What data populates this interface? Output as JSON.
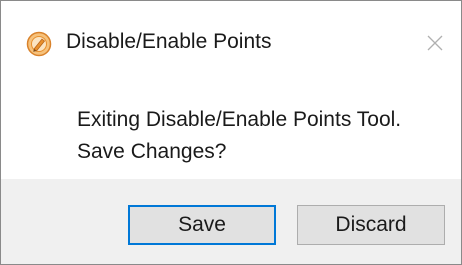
{
  "dialog": {
    "title": "Disable/Enable Points",
    "app_icon": "pen-circle-icon",
    "close_icon": "close-icon",
    "message_line1": "Exiting Disable/Enable Points Tool.",
    "message_line2": "Save Changes?"
  },
  "buttons": {
    "save_label": "Save",
    "discard_label": "Discard"
  },
  "colors": {
    "accent": "#0078d7",
    "footer_bg": "#f0f0f0",
    "button_bg": "#e1e1e1",
    "icon_orange": "#e8902e"
  }
}
